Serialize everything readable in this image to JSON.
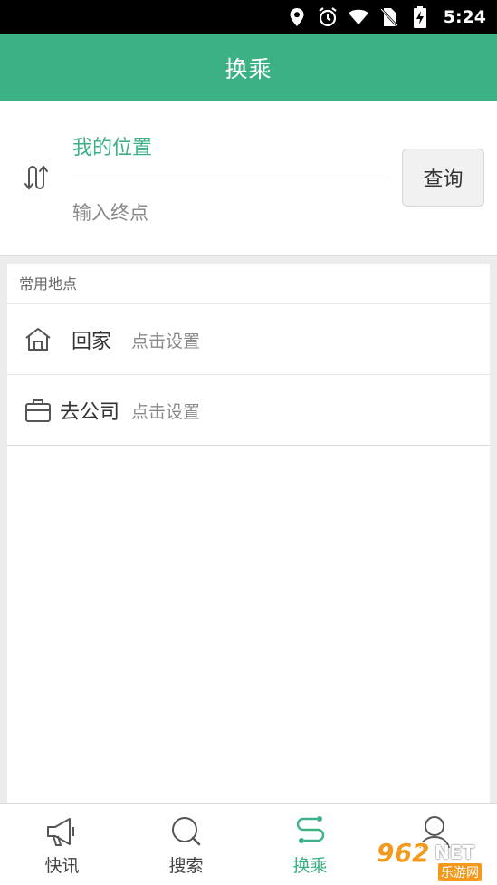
{
  "status_bar": {
    "time": "5:24",
    "icons": [
      "location-icon",
      "alarm-icon",
      "wifi-icon",
      "no-sim-icon",
      "battery-charging-icon"
    ]
  },
  "header": {
    "title": "换乘"
  },
  "route": {
    "origin": "我的位置",
    "destination_placeholder": "输入终点",
    "query_label": "查询",
    "swap_icon": "swap-route-icon"
  },
  "common_places": {
    "title": "常用地点",
    "items": [
      {
        "name": "回家",
        "hint": "点击设置",
        "icon": "home-icon"
      },
      {
        "name": "去公司",
        "hint": "点击设置",
        "icon": "briefcase-icon"
      }
    ]
  },
  "bottom_nav": {
    "items": [
      {
        "label": "快讯",
        "icon": "megaphone-icon"
      },
      {
        "label": "搜索",
        "icon": "search-icon"
      },
      {
        "label": "换乘",
        "icon": "transfer-icon"
      },
      {
        "label": "",
        "icon": "user-icon"
      }
    ],
    "active_index": 2
  },
  "watermark": {
    "logo": "962",
    "net": "NET",
    "sub": "乐游网"
  },
  "colors": {
    "accent": "#3bb184",
    "status_bar": "#000000",
    "background": "#ececec"
  }
}
